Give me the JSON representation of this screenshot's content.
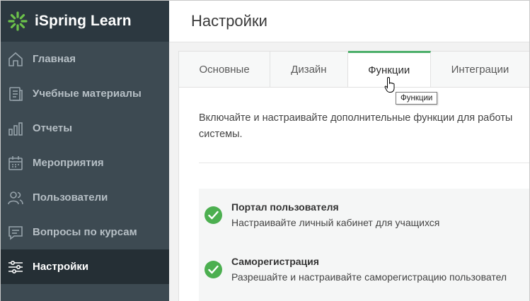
{
  "app": {
    "name": "iSpring Learn",
    "accent_color": "#4caf6a"
  },
  "sidebar": {
    "items": [
      {
        "label": "Главная",
        "icon": "home-icon",
        "active": false
      },
      {
        "label": "Учебные материалы",
        "icon": "materials-icon",
        "active": false
      },
      {
        "label": "Отчеты",
        "icon": "reports-icon",
        "active": false
      },
      {
        "label": "Мероприятия",
        "icon": "calendar-icon",
        "active": false
      },
      {
        "label": "Пользователи",
        "icon": "users-icon",
        "active": false
      },
      {
        "label": "Вопросы по курсам",
        "icon": "questions-icon",
        "active": false
      },
      {
        "label": "Настройки",
        "icon": "settings-icon",
        "active": true
      }
    ]
  },
  "page": {
    "title": "Настройки"
  },
  "tabs": [
    {
      "label": "Основные",
      "active": false
    },
    {
      "label": "Дизайн",
      "active": false
    },
    {
      "label": "Функции",
      "active": true
    },
    {
      "label": "Интеграции",
      "active": false
    }
  ],
  "tooltip": {
    "text": "Функции"
  },
  "content": {
    "description_line1": "Включайте и настраивайте дополнительные функции для работы",
    "description_line2": "системы.",
    "features": [
      {
        "title": "Портал пользователя",
        "description": "Настраивайте личный кабинет для учащихся",
        "enabled": true
      },
      {
        "title": "Саморегистрация",
        "description": "Разрешайте и настраивайте саморегистрацию пользовател",
        "enabled": true
      }
    ]
  }
}
